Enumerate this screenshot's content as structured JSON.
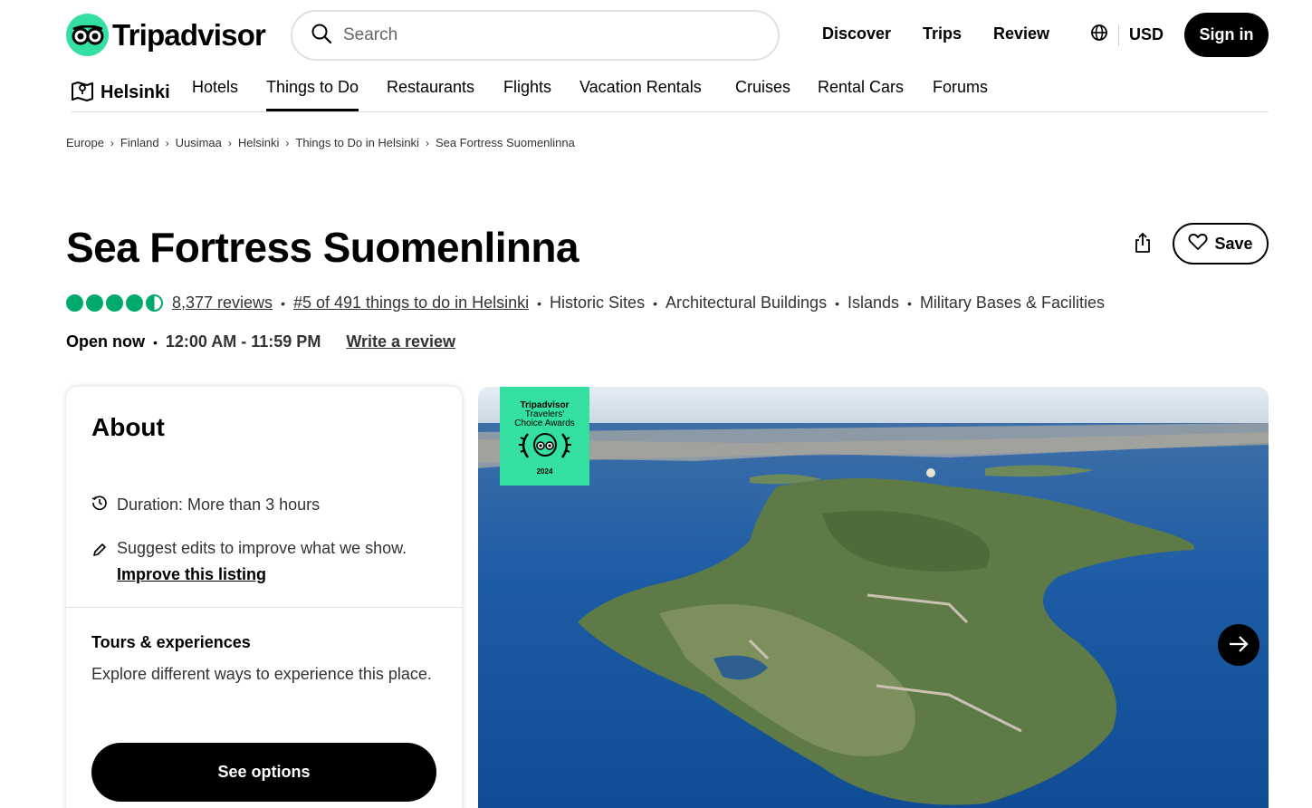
{
  "header": {
    "logo_text": "Tripadvisor",
    "search_placeholder": "Search",
    "nav": [
      "Discover",
      "Trips",
      "Review"
    ],
    "currency": "USD",
    "sign_in": "Sign in"
  },
  "subnav": {
    "home": "Helsinki",
    "items": [
      "Hotels",
      "Things to Do",
      "Restaurants",
      "Flights",
      "Vacation Rentals",
      "Cruises",
      "Rental Cars",
      "Forums"
    ],
    "active": "Things to Do"
  },
  "breadcrumb": [
    "Europe",
    "Finland",
    "Uusimaa",
    "Helsinki",
    "Things to Do in Helsinki",
    "Sea Fortress Suomenlinna"
  ],
  "attraction": {
    "title": "Sea Fortress Suomenlinna",
    "save_label": "Save",
    "rating_value": 4.5,
    "reviews": "8,377 reviews",
    "rank": "#5 of 491 things to do in Helsinki",
    "categories": [
      "Historic Sites",
      "Architectural Buildings",
      "Islands",
      "Military Bases & Facilities"
    ],
    "open_status": "Open now",
    "hours": "12:00 AM - 11:59 PM",
    "write_review": "Write a review"
  },
  "about": {
    "heading": "About",
    "duration": "Duration: More than 3 hours",
    "suggest": "Suggest edits to improve what we show.",
    "improve_link": "Improve this listing",
    "tours_heading": "Tours & experiences",
    "tours_text": "Explore different ways to experience this place.",
    "see_options": "See options"
  },
  "photo_badge": {
    "line1": "Tripadvisor",
    "line2": "Travelers'",
    "line3": "Choice Awards",
    "year": "2024"
  },
  "colors": {
    "brand_green": "#34e0a1",
    "bubble_green": "#00aa6c",
    "text": "#000000"
  },
  "icons": [
    "owl-logo-icon",
    "search-icon",
    "globe-icon",
    "map-icon",
    "share-icon",
    "heart-icon",
    "clock-icon",
    "pencil-icon",
    "arrow-right-icon"
  ]
}
